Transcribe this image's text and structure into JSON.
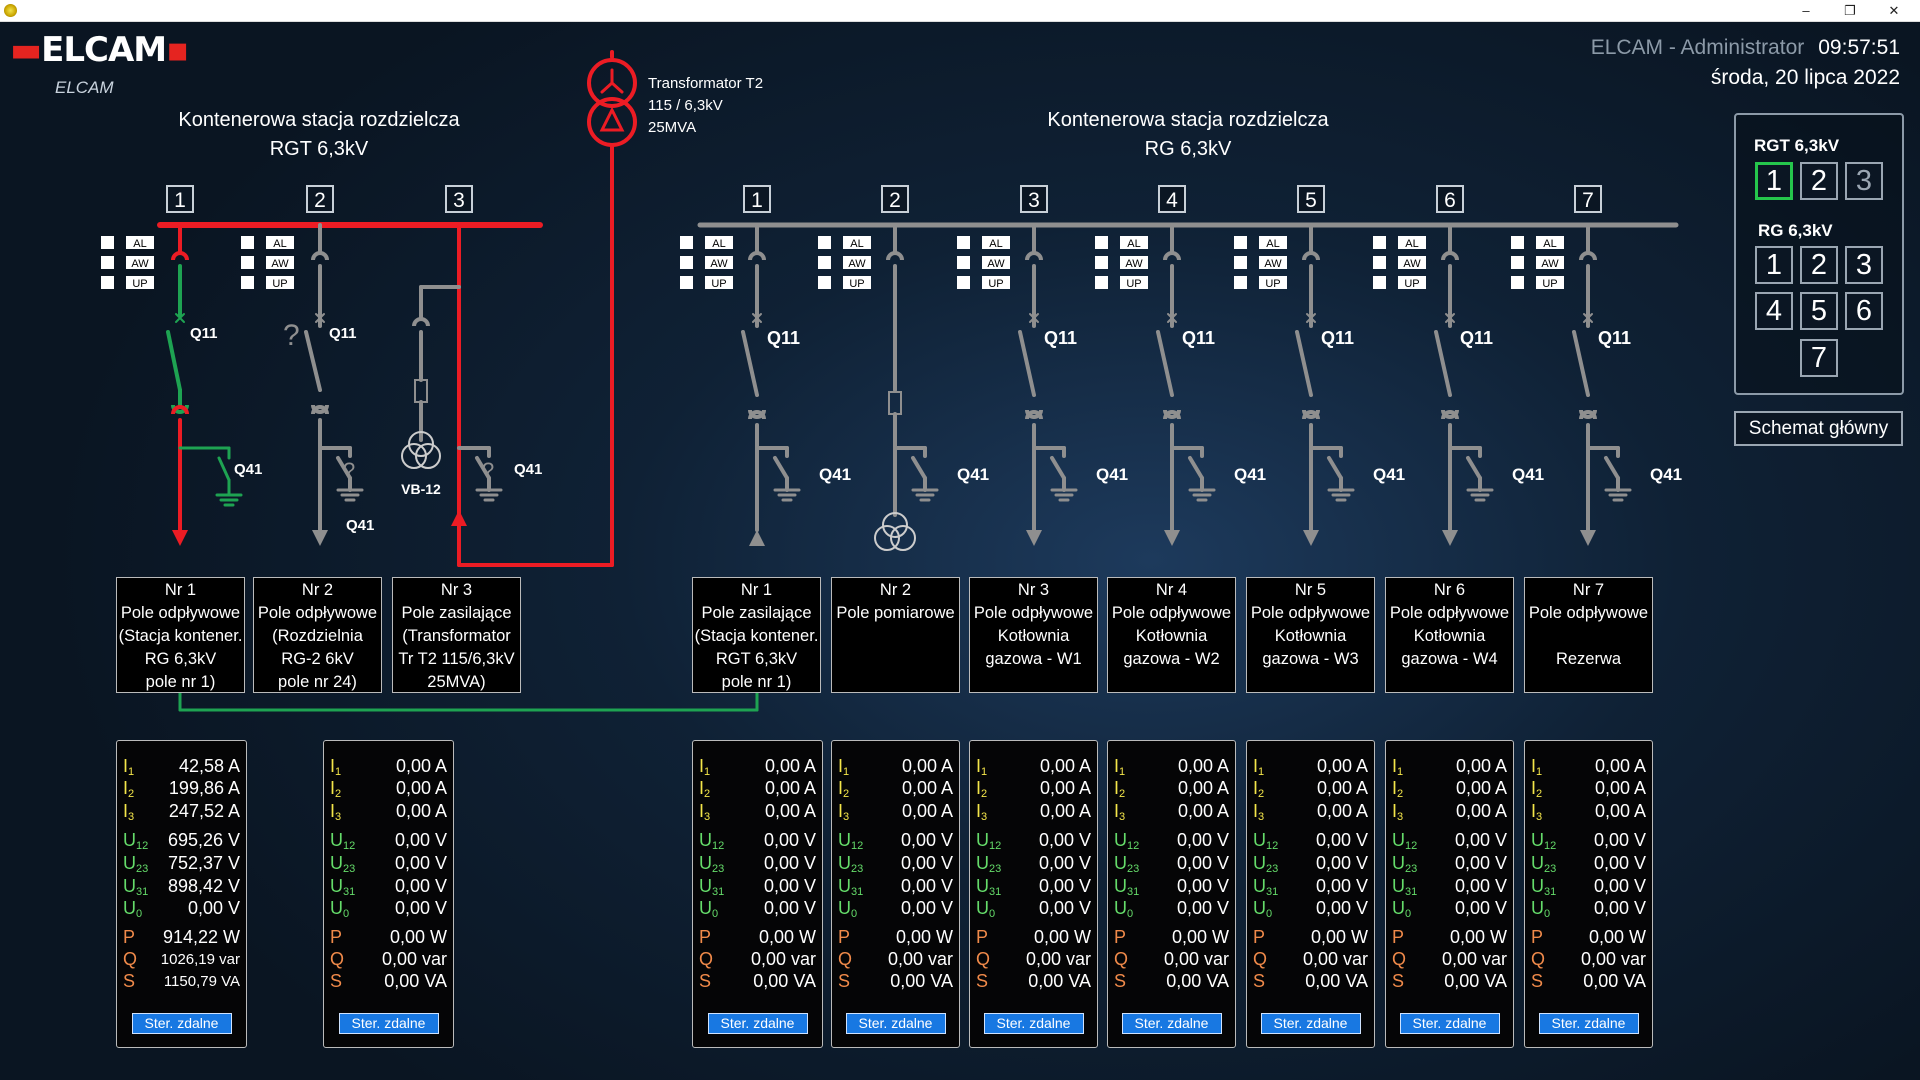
{
  "window": {
    "minimize": "–",
    "restore": "❐",
    "close": "✕"
  },
  "header": {
    "logo_text": "ELCAM",
    "logo_subtitle": "ELCAM",
    "user": "ELCAM - Administrator",
    "time": "09:57:51",
    "date": "środa, 20 lipca 2022"
  },
  "stations": {
    "rgt": {
      "title_line1": "Kontenerowa stacja rozdzielcza",
      "title_line2": "RGT 6,3kV"
    },
    "rg": {
      "title_line1": "Kontenerowa stacja rozdzielcza",
      "title_line2": "RG 6,3kV"
    }
  },
  "transformer": {
    "line1": "Transformator T2",
    "line2": "115 / 6,3kV",
    "line3": "25MVA"
  },
  "colors": {
    "energized": "#ec1c24",
    "deenergized": "#8f8f8f",
    "earthed": "#1ea352",
    "accent_blue": "#1878e2"
  },
  "indicators": [
    "AL",
    "AW",
    "UP"
  ],
  "switch_labels": {
    "disconnector": "Q11",
    "earthing": "Q41",
    "unknown_state": "?",
    "vt": "VB-12"
  },
  "nav": {
    "rgt_label": "RGT 6,3kV",
    "rgt_buttons": [
      "1",
      "2",
      "3"
    ],
    "rg_label": "RG 6,3kV",
    "rg_buttons": [
      "1",
      "2",
      "3",
      "4",
      "5",
      "6",
      "7"
    ],
    "main_button": "Schemat główny"
  },
  "rgt_fields": [
    {
      "num": "1",
      "lines": [
        "Nr 1",
        "Pole odpływowe",
        "(Stacja kontener.",
        "RG 6,3kV",
        "pole nr 1)"
      ]
    },
    {
      "num": "2",
      "lines": [
        "Nr 2",
        "Pole odpływowe",
        "(Rozdzielnia",
        "RG-2 6kV",
        "pole nr 24)"
      ]
    },
    {
      "num": "3",
      "lines": [
        "Nr 3",
        "Pole zasilające",
        "(Transformator",
        "Tr T2 115/6,3kV",
        "25MVA)"
      ]
    }
  ],
  "rg_fields": [
    {
      "num": "1",
      "lines": [
        "Nr 1",
        "Pole zasilające",
        "(Stacja kontener.",
        "RGT 6,3kV",
        "pole nr 1)"
      ]
    },
    {
      "num": "2",
      "lines": [
        "Nr 2",
        "Pole pomiarowe",
        "",
        "",
        ""
      ]
    },
    {
      "num": "3",
      "lines": [
        "Nr 3",
        "Pole odpływowe",
        "Kotłownia",
        "gazowa - W1",
        ""
      ]
    },
    {
      "num": "4",
      "lines": [
        "Nr 4",
        "Pole odpływowe",
        "Kotłownia",
        "gazowa - W2",
        ""
      ]
    },
    {
      "num": "5",
      "lines": [
        "Nr 5",
        "Pole odpływowe",
        "Kotłownia",
        "gazowa - W3",
        ""
      ]
    },
    {
      "num": "6",
      "lines": [
        "Nr 6",
        "Pole odpływowe",
        "Kotłownia",
        "gazowa - W4",
        ""
      ]
    },
    {
      "num": "7",
      "lines": [
        "Nr 7",
        "Pole odpływowe",
        "",
        "Rezerwa",
        ""
      ]
    }
  ],
  "meter_labels": {
    "I": "I",
    "U": "U",
    "U0": "U",
    "P": "P",
    "Q": "Q",
    "S": "S",
    "subs": [
      "1",
      "2",
      "3",
      "12",
      "23",
      "31",
      "0"
    ]
  },
  "meters": [
    {
      "id": "rgt-1",
      "I1": "42,58 A",
      "I2": "199,86 A",
      "I3": "247,52 A",
      "U12": "695,26 V",
      "U23": "752,37 V",
      "U31": "898,42 V",
      "U0": "0,00 V",
      "P": "914,22 W",
      "Q": "1026,19 var",
      "S": "1150,79 VA",
      "button": "Ster. zdalne"
    },
    {
      "id": "rgt-2",
      "I1": "0,00 A",
      "I2": "0,00 A",
      "I3": "0,00 A",
      "U12": "0,00 V",
      "U23": "0,00 V",
      "U31": "0,00 V",
      "U0": "0,00 V",
      "P": "0,00 W",
      "Q": "0,00 var",
      "S": "0,00 VA",
      "button": "Ster. zdalne"
    },
    {
      "id": "rg-1",
      "I1": "0,00 A",
      "I2": "0,00 A",
      "I3": "0,00 A",
      "U12": "0,00 V",
      "U23": "0,00 V",
      "U31": "0,00 V",
      "U0": "0,00 V",
      "P": "0,00 W",
      "Q": "0,00 var",
      "S": "0,00 VA",
      "button": "Ster. zdalne"
    },
    {
      "id": "rg-2",
      "I1": "0,00 A",
      "I2": "0,00 A",
      "I3": "0,00 A",
      "U12": "0,00 V",
      "U23": "0,00 V",
      "U31": "0,00 V",
      "U0": "0,00 V",
      "P": "0,00 W",
      "Q": "0,00 var",
      "S": "0,00 VA",
      "button": "Ster. zdalne"
    },
    {
      "id": "rg-3",
      "I1": "0,00 A",
      "I2": "0,00 A",
      "I3": "0,00 A",
      "U12": "0,00 V",
      "U23": "0,00 V",
      "U31": "0,00 V",
      "U0": "0,00 V",
      "P": "0,00 W",
      "Q": "0,00 var",
      "S": "0,00 VA",
      "button": "Ster. zdalne"
    },
    {
      "id": "rg-4",
      "I1": "0,00 A",
      "I2": "0,00 A",
      "I3": "0,00 A",
      "U12": "0,00 V",
      "U23": "0,00 V",
      "U31": "0,00 V",
      "U0": "0,00 V",
      "P": "0,00 W",
      "Q": "0,00 var",
      "S": "0,00 VA",
      "button": "Ster. zdalne"
    },
    {
      "id": "rg-5",
      "I1": "0,00 A",
      "I2": "0,00 A",
      "I3": "0,00 A",
      "U12": "0,00 V",
      "U23": "0,00 V",
      "U31": "0,00 V",
      "U0": "0,00 V",
      "P": "0,00 W",
      "Q": "0,00 var",
      "S": "0,00 VA",
      "button": "Ster. zdalne"
    },
    {
      "id": "rg-6",
      "I1": "0,00 A",
      "I2": "0,00 A",
      "I3": "0,00 A",
      "U12": "0,00 V",
      "U23": "0,00 V",
      "U31": "0,00 V",
      "U0": "0,00 V",
      "P": "0,00 W",
      "Q": "0,00 var",
      "S": "0,00 VA",
      "button": "Ster. zdalne"
    },
    {
      "id": "rg-7",
      "I1": "0,00 A",
      "I2": "0,00 A",
      "I3": "0,00 A",
      "U12": "0,00 V",
      "U23": "0,00 V",
      "U31": "0,00 V",
      "U0": "0,00 V",
      "P": "0,00 W",
      "Q": "0,00 var",
      "S": "0,00 VA",
      "button": "Ster. zdalne"
    }
  ]
}
